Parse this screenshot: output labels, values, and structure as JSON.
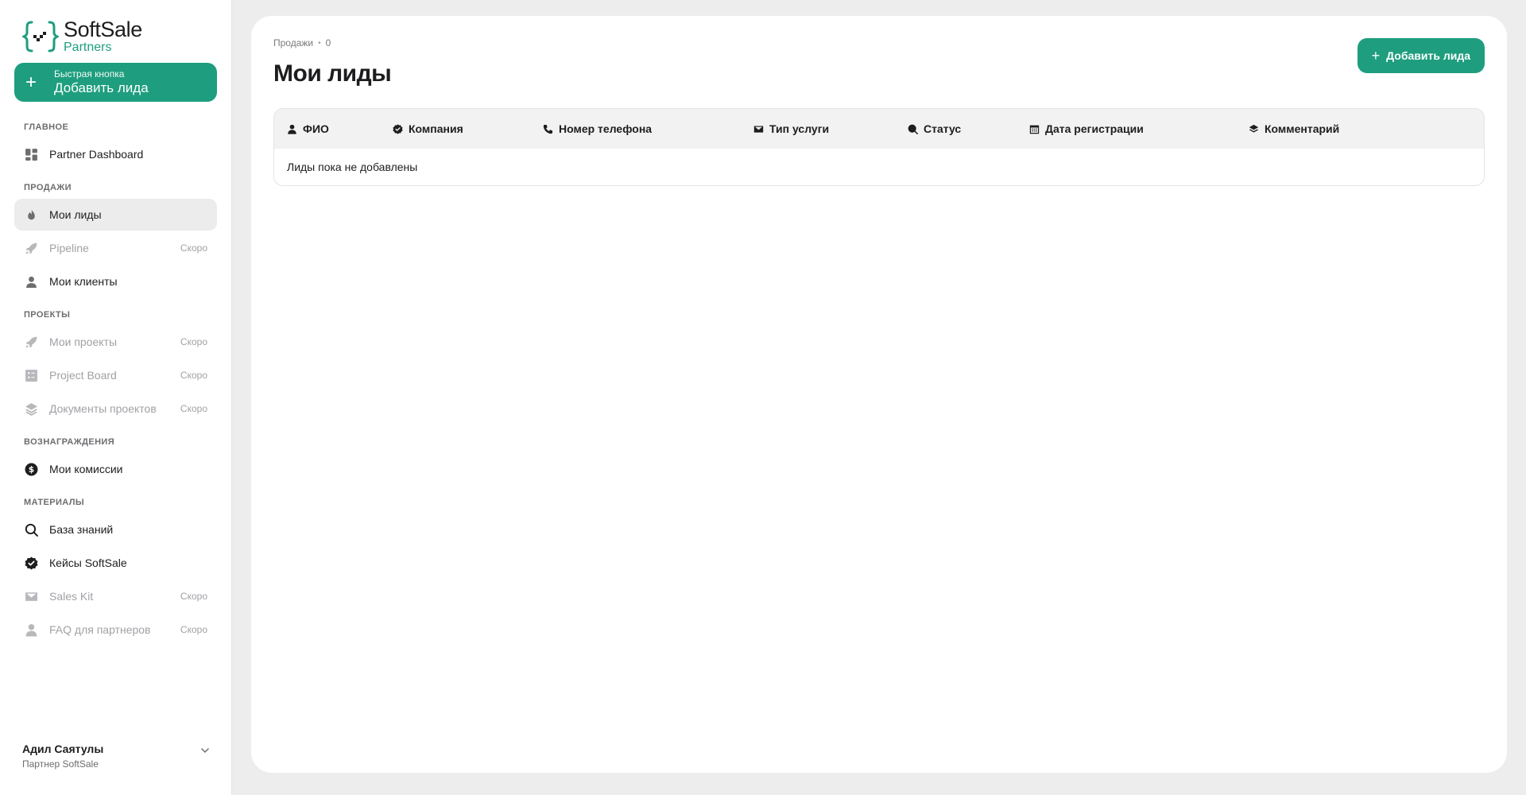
{
  "brand": {
    "name": "SoftSale",
    "sub": "Partners",
    "accent": "#1e9e7e"
  },
  "quick_button": {
    "small": "Быстрая кнопка",
    "label": "Добавить лида"
  },
  "nav": {
    "main_section": "ГЛАВНОЕ",
    "main_items": [
      {
        "label": "Partner Dashboard",
        "icon": "dashboard-icon"
      }
    ],
    "sales_section": "ПРОДАЖИ",
    "sales_items": [
      {
        "label": "Мои лиды",
        "icon": "fire-icon",
        "active": true
      },
      {
        "label": "Pipeline",
        "icon": "rocket-icon",
        "badge": "Скоро"
      },
      {
        "label": "Мои клиенты",
        "icon": "user-icon"
      }
    ],
    "projects_section": "ПРОЕКТЫ",
    "projects_items": [
      {
        "label": "Мои проекты",
        "icon": "rocket-icon",
        "badge": "Скоро"
      },
      {
        "label": "Project Board",
        "icon": "board-icon",
        "badge": "Скоро"
      },
      {
        "label": "Документы проектов",
        "icon": "layers-icon",
        "badge": "Скоро"
      }
    ],
    "rewards_section": "ВОЗНАГРАЖДЕНИЯ",
    "rewards_items": [
      {
        "label": "Мои комиссии",
        "icon": "dollar-icon"
      }
    ],
    "materials_section": "МАТЕРИАЛЫ",
    "materials_items": [
      {
        "label": "База знаний",
        "icon": "search-icon"
      },
      {
        "label": "Кейсы SoftSale",
        "icon": "verified-icon"
      },
      {
        "label": "Sales Kit",
        "icon": "mail-icon",
        "badge": "Скоро"
      },
      {
        "label": "FAQ для партнеров",
        "icon": "user-icon",
        "badge": "Скоро"
      }
    ]
  },
  "user": {
    "name": "Адил Саятулы",
    "role": "Партнер SoftSale"
  },
  "page": {
    "breadcrumb": "Продажи",
    "count": "0",
    "title": "Мои лиды",
    "add_button": "Добавить лида"
  },
  "table": {
    "columns": [
      {
        "label": "ФИО",
        "icon": "user-icon"
      },
      {
        "label": "Компания",
        "icon": "verified-icon"
      },
      {
        "label": "Номер телефона",
        "icon": "phone-icon"
      },
      {
        "label": "Тип услуги",
        "icon": "mail-icon"
      },
      {
        "label": "Статус",
        "icon": "search-icon"
      },
      {
        "label": "Дата регистрации",
        "icon": "calendar-icon"
      },
      {
        "label": "Комментарий",
        "icon": "layers-icon"
      }
    ],
    "empty": "Лиды пока не добавлены"
  }
}
